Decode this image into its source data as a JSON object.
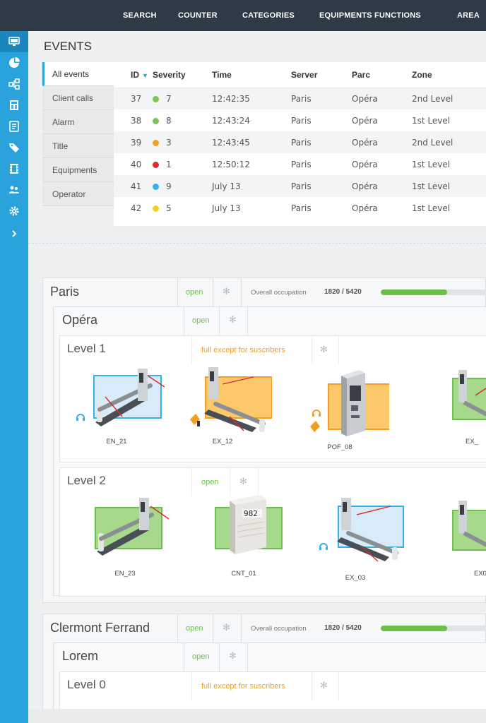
{
  "nav": {
    "items": [
      "SEARCH",
      "COUNTER",
      "CATEGORIES",
      "EQUIPMENTS FUNCTIONS",
      "AREA"
    ]
  },
  "sidebar": {
    "icons": [
      "monitor-icon",
      "pie-chart-icon",
      "network-icon",
      "calculator-icon",
      "document-icon",
      "tag-icon",
      "film-icon",
      "users-icon",
      "gear-icon",
      "chevron-right-icon"
    ]
  },
  "events": {
    "title": "EVENTS",
    "tabs": [
      "All events",
      "Client calls",
      "Alarm",
      "Title",
      "Equipments",
      "Operator"
    ],
    "columns": [
      "ID",
      "Severity",
      "Time",
      "Server",
      "Parc",
      "Zone"
    ],
    "rows": [
      {
        "id": "37",
        "severity": "7",
        "color": "#7dc25c",
        "time": "12:42:35",
        "server": "Paris",
        "parc": "Opéra",
        "zone": "2nd Level"
      },
      {
        "id": "38",
        "severity": "8",
        "color": "#7dc25c",
        "time": "12:43:24",
        "server": "Paris",
        "parc": "Opéra",
        "zone": "1st Level"
      },
      {
        "id": "39",
        "severity": "3",
        "color": "#f39c28",
        "time": "12:43:45",
        "server": "Paris",
        "parc": "Opéra",
        "zone": "2nd Level"
      },
      {
        "id": "40",
        "severity": "1",
        "color": "#e02a2a",
        "time": "12:50:12",
        "server": "Paris",
        "parc": "Opéra",
        "zone": "1st Level"
      },
      {
        "id": "41",
        "severity": "9",
        "color": "#3aaee6",
        "time": "July 13",
        "server": "Paris",
        "parc": "Opéra",
        "zone": "1st Level"
      },
      {
        "id": "42",
        "severity": "5",
        "color": "#f4d023",
        "time": "July 13",
        "server": "Paris",
        "parc": "Opéra",
        "zone": "1st Level"
      }
    ]
  },
  "paris": {
    "name": "Paris",
    "status": "open",
    "occupation_label": "Overall occupation",
    "occupation_value": "1820 / 5420",
    "occupation_fraction": 0.336,
    "opera": {
      "name": "Opéra",
      "status": "open",
      "level1": {
        "name": "Level 1",
        "status": "full except for suscribers",
        "equipments": [
          "EN_21",
          "EX_12",
          "POF_08",
          "EX_"
        ]
      },
      "level2": {
        "name": "Level 2",
        "status": "open",
        "equipments": [
          "EN_23",
          "CNT_01",
          "EX_03",
          "EX0"
        ],
        "counter_display": "982"
      }
    }
  },
  "clermont": {
    "name": "Clermont Ferrand",
    "status": "open",
    "occupation_label": "Overall occupation",
    "occupation_value": "1820 / 5420",
    "occupation_fraction": 0.336,
    "lorem": {
      "name": "Lorem",
      "status": "open",
      "level0": {
        "name": "Level 0",
        "status": "full except for suscribers"
      }
    }
  },
  "colors": {
    "nav_bg": "#2e3a47",
    "sidebar_bg": "#2aa3dc",
    "open_green": "#6cc04a",
    "full_orange": "#f0a020"
  }
}
